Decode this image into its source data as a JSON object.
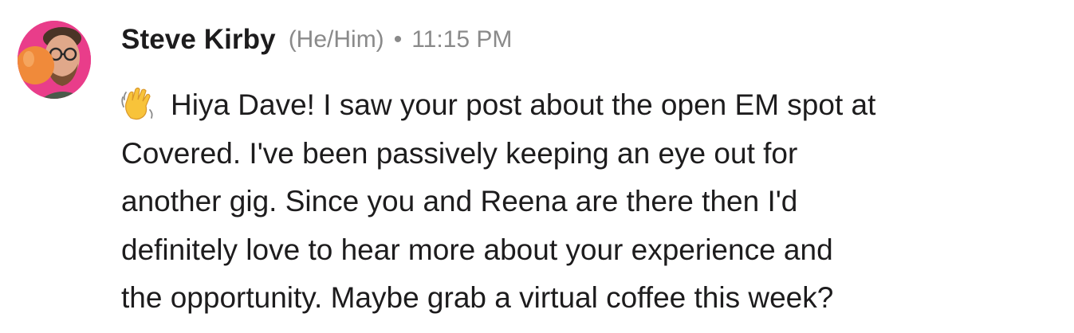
{
  "message": {
    "author": {
      "name": "Steve Kirby",
      "pronouns": "(He/Him)"
    },
    "separator": "•",
    "timestamp": "11:15 PM",
    "emoji": "waving-hand-icon",
    "lines": [
      "Hiya Dave! I saw your post about the open EM spot at",
      "Covered. I've been passively keeping an eye out for",
      "another gig. Since you and Reena are there then I'd",
      "definitely love to hear more about your experience and",
      "the opportunity. Maybe grab a virtual coffee this week?"
    ]
  },
  "colors": {
    "text": "#1d1c1d",
    "meta": "#8a8a8a",
    "avatar_bg": "#e93d8a"
  }
}
